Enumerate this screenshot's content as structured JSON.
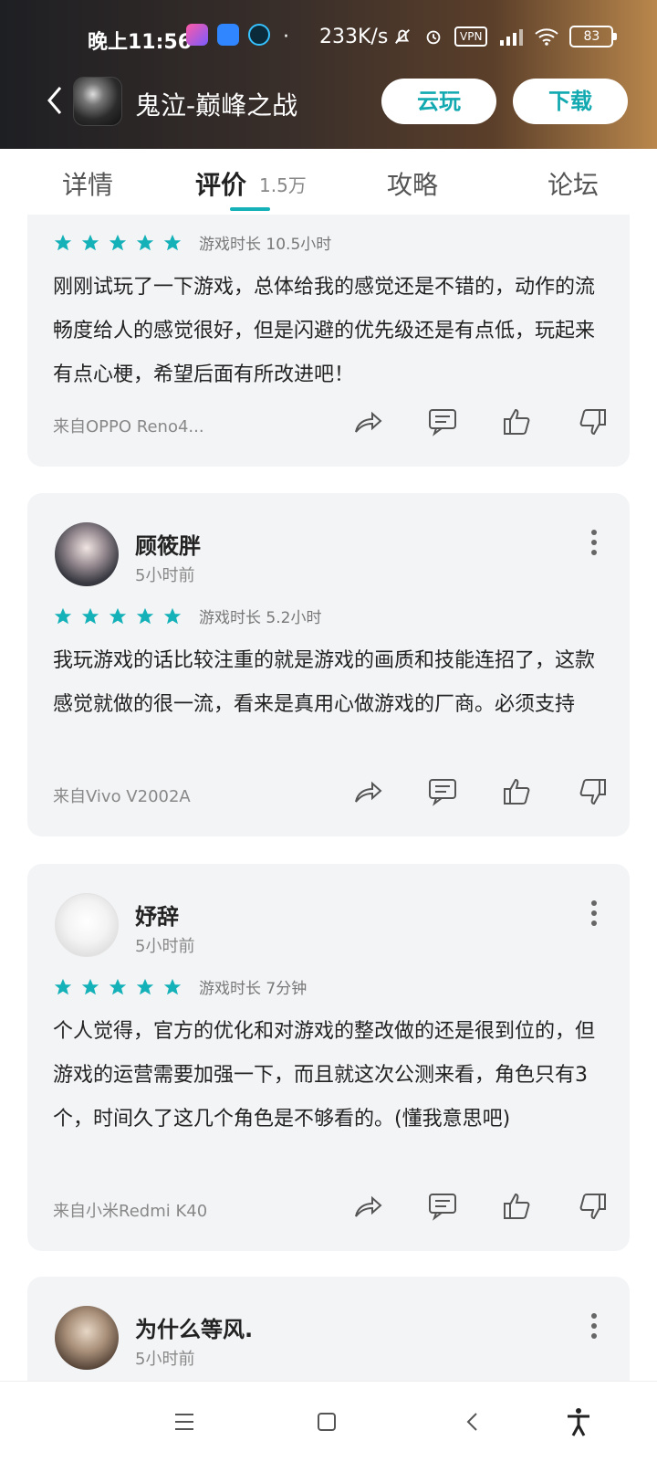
{
  "status_bar": {
    "time": "晚上11:56",
    "net_speed": "233K/s",
    "vpn": "VPN",
    "battery": "83",
    "dot": "·"
  },
  "header": {
    "game_title": "鬼泣-巅峰之战",
    "cloud_play": "云玩",
    "download": "下载",
    "accent_color": "#14b2b8"
  },
  "tabs": [
    {
      "label": "详情"
    },
    {
      "label": "评价",
      "count": "1.5万"
    },
    {
      "label": "攻略"
    },
    {
      "label": "论坛"
    }
  ],
  "reviews": [
    {
      "playtime": "游戏时长 10.5小时",
      "stars": 5,
      "text": "刚刚试玩了一下游戏，总体给我的感觉还是不错的，动作的流畅度给人的感觉很好，但是闪避的优先级还是有点低，玩起来有点心梗，希望后面有所改进吧！",
      "device": "来自OPPO Reno4..."
    },
    {
      "username": "顾筱胖",
      "posted": "5小时前",
      "playtime": "游戏时长 5.2小时",
      "stars": 5,
      "text": "我玩游戏的话比较注重的就是游戏的画质和技能连招了，这款感觉就做的很一流，看来是真用心做游戏的厂商。必须支持",
      "device": "来自Vivo V2002A"
    },
    {
      "username": "妤辞",
      "posted": "5小时前",
      "playtime": "游戏时长 7分钟",
      "stars": 5,
      "text": "个人觉得，官方的优化和对游戏的整改做的还是很到位的，但游戏的运营需要加强一下，而且就这次公测来看，角色只有3个，时间久了这几个角色是不够看的。(懂我意思吧)",
      "device": "来自小米Redmi K40"
    },
    {
      "username": "为什么等风.",
      "posted": "5小时前"
    }
  ]
}
